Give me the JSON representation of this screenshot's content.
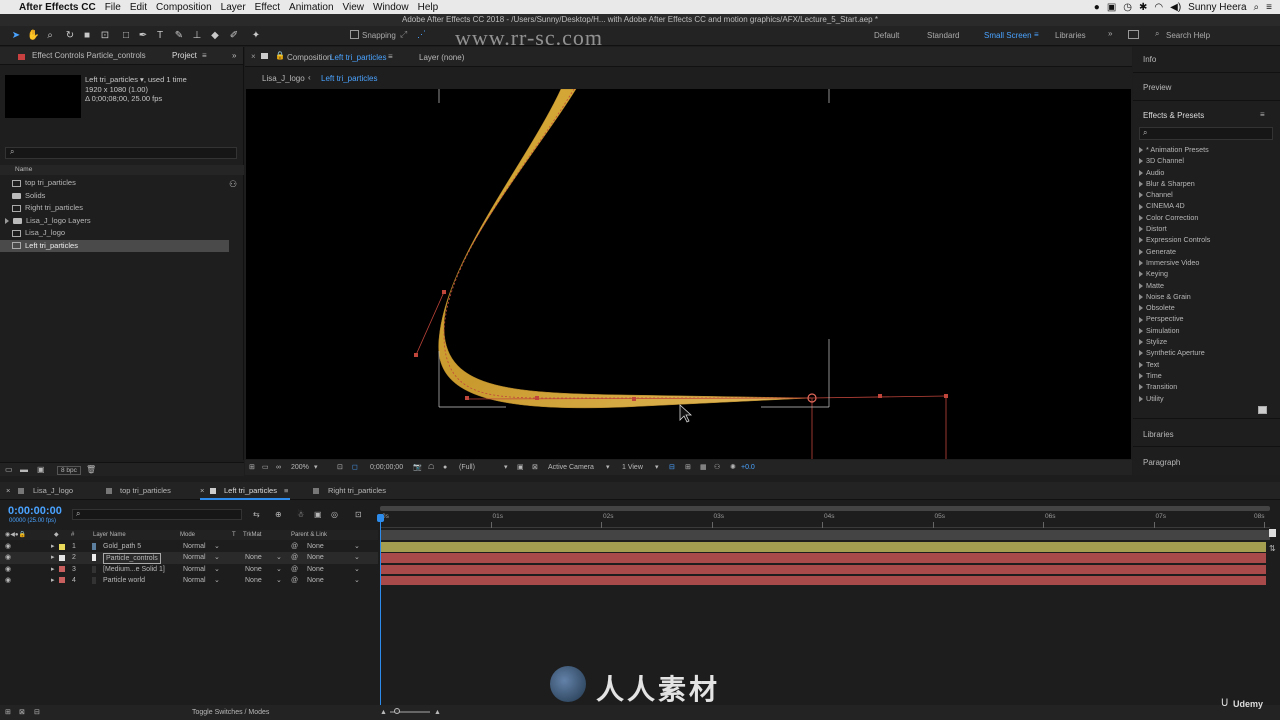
{
  "menubar": {
    "app": "After Effects CC",
    "items": [
      "File",
      "Edit",
      "Composition",
      "Layer",
      "Effect",
      "Animation",
      "View",
      "Window",
      "Help"
    ],
    "user": "Sunny Heera"
  },
  "title": "Adobe After Effects CC 2018 - /Users/Sunny/Desktop/H... with Adobe After Effects CC and motion graphics/AFX/Lecture_5_Start.aep *",
  "watermark": "www.rr-sc.com",
  "toolbar": {
    "snapping": "Snapping",
    "workspaces": [
      "Default",
      "Standard",
      "Small Screen",
      "Libraries"
    ],
    "search_help": "Search Help"
  },
  "effect_controls": {
    "label": "Effect Controls Particle_controls",
    "project_tab": "Project"
  },
  "project": {
    "item_name": "Left tri_particles",
    "used": ", used 1 time",
    "resolution": "1920 x 1080 (1.00)",
    "duration": "Δ 0;00;08;00, 25.00 fps",
    "search_placeholder": "",
    "col_name": "Name",
    "items": [
      {
        "name": "top tri_particles",
        "type": "comp"
      },
      {
        "name": "Solids",
        "type": "folder"
      },
      {
        "name": "Right tri_particles",
        "type": "comp"
      },
      {
        "name": "Lisa_J_logo Layers",
        "type": "folder"
      },
      {
        "name": "Lisa_J_logo",
        "type": "comp"
      },
      {
        "name": "Left tri_particles",
        "type": "comp"
      }
    ],
    "bpc": "8 bpc"
  },
  "composition": {
    "tab_prefix": "Composition",
    "tab_name": "Left tri_particles",
    "layer_tab": "Layer (none)",
    "breadcrumbs": [
      "Lisa_J_logo",
      "Left tri_particles"
    ],
    "zoom": "200%",
    "timecode": "0;00;00;00",
    "resolution": "(Full)",
    "camera": "Active Camera",
    "views": "1 View",
    "exposure": "+0.0"
  },
  "right_panels": {
    "info": "Info",
    "preview": "Preview",
    "effects_presets": "Effects & Presets",
    "libraries": "Libraries",
    "paragraph": "Paragraph",
    "categories": [
      "* Animation Presets",
      "3D Channel",
      "Audio",
      "Blur & Sharpen",
      "Channel",
      "CINEMA 4D",
      "Color Correction",
      "Distort",
      "Expression Controls",
      "Generate",
      "Immersive Video",
      "Keying",
      "Matte",
      "Noise & Grain",
      "Obsolete",
      "Perspective",
      "Simulation",
      "Stylize",
      "Synthetic Aperture",
      "Text",
      "Time",
      "Transition",
      "Utility"
    ]
  },
  "timeline": {
    "tabs": [
      "Lisa_J_logo",
      "top tri_particles",
      "Left tri_particles",
      "Right tri_particles"
    ],
    "timecode": "0:00:00:00",
    "fps": "00000 (25.00 fps)",
    "cols": {
      "num": "#",
      "name": "Layer Name",
      "mode": "Mode",
      "t": "T",
      "trkmat": "TrkMat",
      "parent": "Parent & Link"
    },
    "layers": [
      {
        "num": "1",
        "name": "Gold_path 5",
        "mode": "Normal",
        "trkmat": "",
        "parent": "None",
        "label": "#e8d95a",
        "bar": "#a49f50"
      },
      {
        "num": "2",
        "name": "Particle_controls",
        "mode": "Normal",
        "trkmat": "None",
        "parent": "None",
        "label": "#e6e6e6",
        "bar": "#a84a4a"
      },
      {
        "num": "3",
        "name": "[Medium...e Solid 1]",
        "mode": "Normal",
        "trkmat": "None",
        "parent": "None",
        "label": "#c86060",
        "bar": "#a84a4a"
      },
      {
        "num": "4",
        "name": "Particle world",
        "mode": "Normal",
        "trkmat": "None",
        "parent": "None",
        "label": "#c86060",
        "bar": "#a84a4a"
      }
    ],
    "ruler": [
      "0s",
      "01s",
      "02s",
      "03s",
      "04s",
      "05s",
      "06s",
      "07s",
      "08s"
    ],
    "toggle": "Toggle Switches / Modes"
  },
  "brand": {
    "site": "人人素材",
    "udemy": "Udemy"
  },
  "colors": {
    "accent": "#2d8ceb",
    "gold": "#c9a030",
    "path": "#c0453b"
  }
}
